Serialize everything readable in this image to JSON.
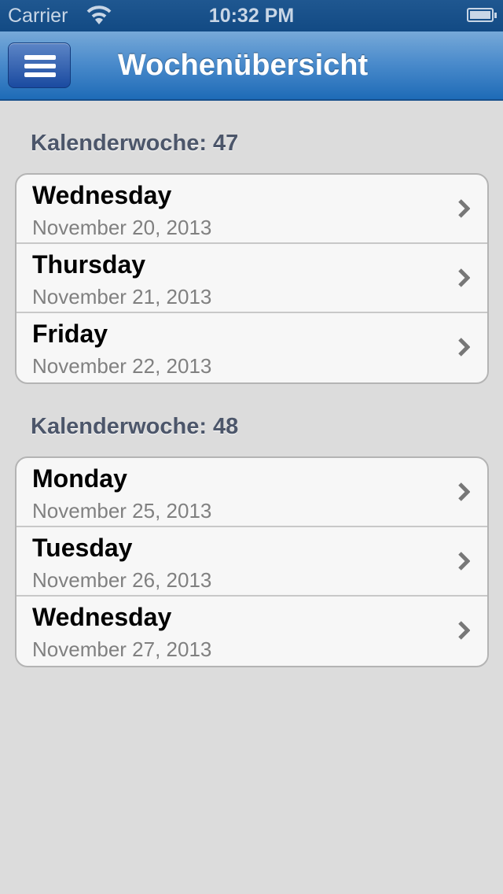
{
  "status_bar": {
    "carrier": "Carrier",
    "time": "10:32 PM"
  },
  "nav": {
    "title": "Wochenübersicht"
  },
  "sections": [
    {
      "header": "Kalenderwoche: 47",
      "rows": [
        {
          "day": "Wednesday",
          "date": "November 20, 2013"
        },
        {
          "day": "Thursday",
          "date": "November 21, 2013"
        },
        {
          "day": "Friday",
          "date": "November 22, 2013"
        }
      ]
    },
    {
      "header": "Kalenderwoche: 48",
      "rows": [
        {
          "day": "Monday",
          "date": "November 25, 2013"
        },
        {
          "day": "Tuesday",
          "date": "November 26, 2013"
        },
        {
          "day": "Wednesday",
          "date": "November 27, 2013"
        }
      ]
    }
  ]
}
